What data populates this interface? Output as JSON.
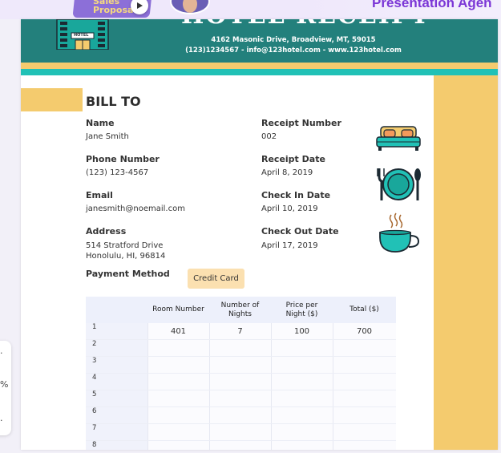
{
  "banner": {
    "thumb_text": "Sales\nProposal",
    "promo_text": "Presentation Agen"
  },
  "sidepanel": {
    "items": [
      ".",
      "%",
      "."
    ]
  },
  "receipt": {
    "title": "HOTEL RECEIPT",
    "address": "4162 Masonic Drive, Broadview, MT, 59015",
    "contact": "(123)1234567 - info@123hotel.com - www.123hotel.com",
    "building_sign": "HOTEL",
    "bill_to_heading": "BILL TO",
    "name_label": "Name",
    "name_value": "Jane Smith",
    "phone_label": "Phone Number",
    "phone_value": "(123) 123-4567",
    "email_label": "Email",
    "email_value": "janesmith@noemail.com",
    "address_label": "Address",
    "address_line1": "514 Stratford Drive",
    "address_line2": "Honolulu, HI, 96814",
    "payment_label": "Payment Method",
    "payment_value": "Credit Card",
    "receipt_number_label": "Receipt Number",
    "receipt_number_value": "002",
    "receipt_date_label": "Receipt Date",
    "receipt_date_value": "April 8, 2019",
    "checkin_label": "Check In Date",
    "checkin_value": "April 10, 2019",
    "checkout_label": "Check Out Date",
    "checkout_value": "April 17, 2019"
  },
  "table": {
    "headers": [
      "Room Number",
      "Number of\nNights",
      "Price per\nNight ($)",
      "Total ($)"
    ],
    "rows": [
      {
        "idx": "1",
        "room": "401",
        "nights": "7",
        "price": "100",
        "total": "700"
      },
      {
        "idx": "2",
        "room": "",
        "nights": "",
        "price": "",
        "total": ""
      },
      {
        "idx": "3",
        "room": "",
        "nights": "",
        "price": "",
        "total": ""
      },
      {
        "idx": "4",
        "room": "",
        "nights": "",
        "price": "",
        "total": ""
      },
      {
        "idx": "5",
        "room": "",
        "nights": "",
        "price": "",
        "total": ""
      },
      {
        "idx": "6",
        "room": "",
        "nights": "",
        "price": "",
        "total": ""
      },
      {
        "idx": "7",
        "room": "",
        "nights": "",
        "price": "",
        "total": ""
      },
      {
        "idx": "8",
        "room": "",
        "nights": "",
        "price": "",
        "total": ""
      }
    ]
  },
  "colors": {
    "header_teal": "#23807c",
    "stripe_yellow": "#f4cb6e",
    "stripe_teal": "#21c1b6",
    "badge_bg": "#fbe0b0",
    "promo_purple": "#7b36d6"
  },
  "icons": [
    "hotel-building-icon",
    "bed-icon",
    "plate-cutlery-icon",
    "coffee-cup-icon",
    "play-icon"
  ]
}
